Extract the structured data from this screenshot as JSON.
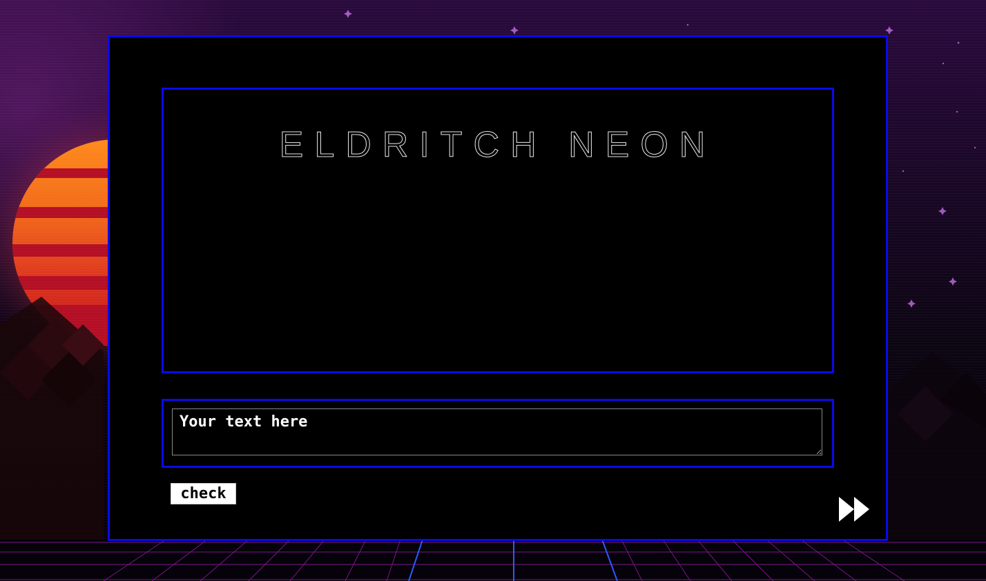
{
  "game": {
    "title": "ELDRITCH NEON",
    "input_placeholder": "Your text here",
    "input_value": "",
    "check_label": "check"
  },
  "icons": {
    "skip": "fast-forward-icon"
  },
  "colors": {
    "frame_border": "#0a0aea",
    "panel_background": "#000000",
    "text": "#ffffff",
    "sun_top": "#ff8a1c",
    "sun_bottom": "#c0101e",
    "grid_lines": "#b01fbd"
  }
}
